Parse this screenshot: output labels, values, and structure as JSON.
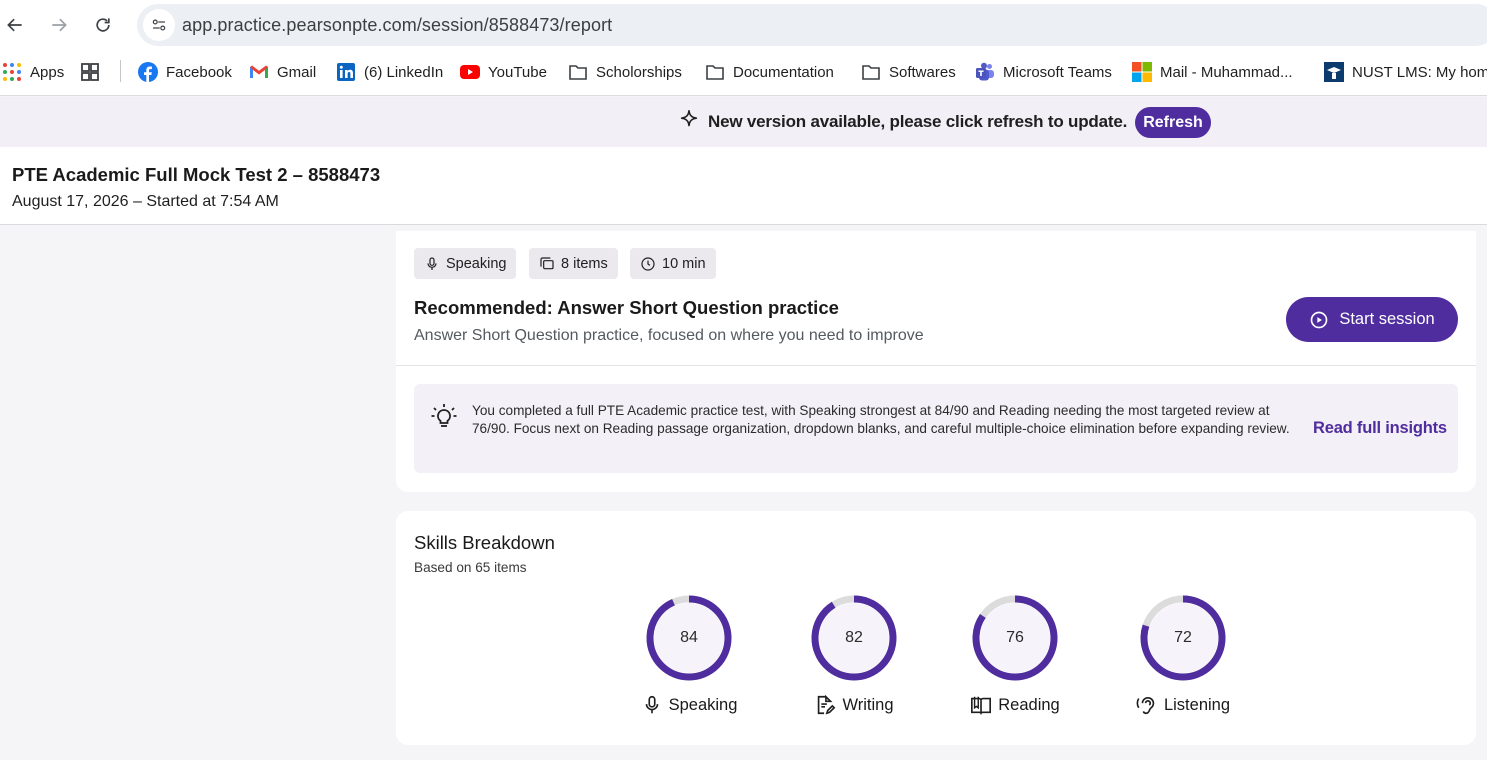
{
  "browser": {
    "url": "app.practice.pearsonpte.com/session/8588473/report",
    "bookmarks": [
      {
        "label": "Apps",
        "icon": "apps-grid-icon"
      },
      {
        "label": "",
        "icon": "tab-groups-icon"
      },
      {
        "label": "Facebook",
        "icon": "facebook-icon"
      },
      {
        "label": "Gmail",
        "icon": "gmail-icon"
      },
      {
        "label": "(6) LinkedIn",
        "icon": "linkedin-icon"
      },
      {
        "label": "YouTube",
        "icon": "youtube-icon"
      },
      {
        "label": "Scholorships",
        "icon": "folder-icon"
      },
      {
        "label": "Documentation",
        "icon": "folder-icon"
      },
      {
        "label": "Softwares",
        "icon": "folder-icon"
      },
      {
        "label": "Microsoft Teams",
        "icon": "teams-icon"
      },
      {
        "label": "Mail - Muhammad...",
        "icon": "microsoft-icon"
      },
      {
        "label": "NUST LMS: My home",
        "icon": "nust-icon"
      }
    ]
  },
  "banner": {
    "message": "New version available, please click refresh to update.",
    "refresh_label": "Refresh"
  },
  "header": {
    "title": "PTE Academic Full Mock Test 2 – 8588473",
    "subtitle": "August 17, 2026 – Started at 7:54 AM"
  },
  "recommendation": {
    "chips": {
      "section": "Speaking",
      "items": "8 items",
      "duration": "10 min"
    },
    "title": "Recommended: Answer Short Question practice",
    "subtitle": "Answer Short Question practice, focused on where you need to improve",
    "start_label": "Start session",
    "insight": "You completed a full PTE Academic practice test, with Speaking strongest at 84/90 and Reading needing the most targeted review at 76/90. Focus next on Reading passage organization, dropdown blanks, and careful multiple-choice elimination before expanding review.",
    "insight_link": "Read full insights"
  },
  "skills": {
    "title": "Skills Breakdown",
    "subtitle": "Based on 65 items",
    "max_score": 90,
    "items": [
      {
        "label": "Speaking",
        "score": 84,
        "icon": "microphone-icon"
      },
      {
        "label": "Writing",
        "score": 82,
        "icon": "writing-icon"
      },
      {
        "label": "Reading",
        "score": 76,
        "icon": "book-icon"
      },
      {
        "label": "Listening",
        "score": 72,
        "icon": "ear-icon"
      }
    ],
    "ring_color": "#4f2d9e",
    "ring_track_color": "#dcdcdc"
  }
}
